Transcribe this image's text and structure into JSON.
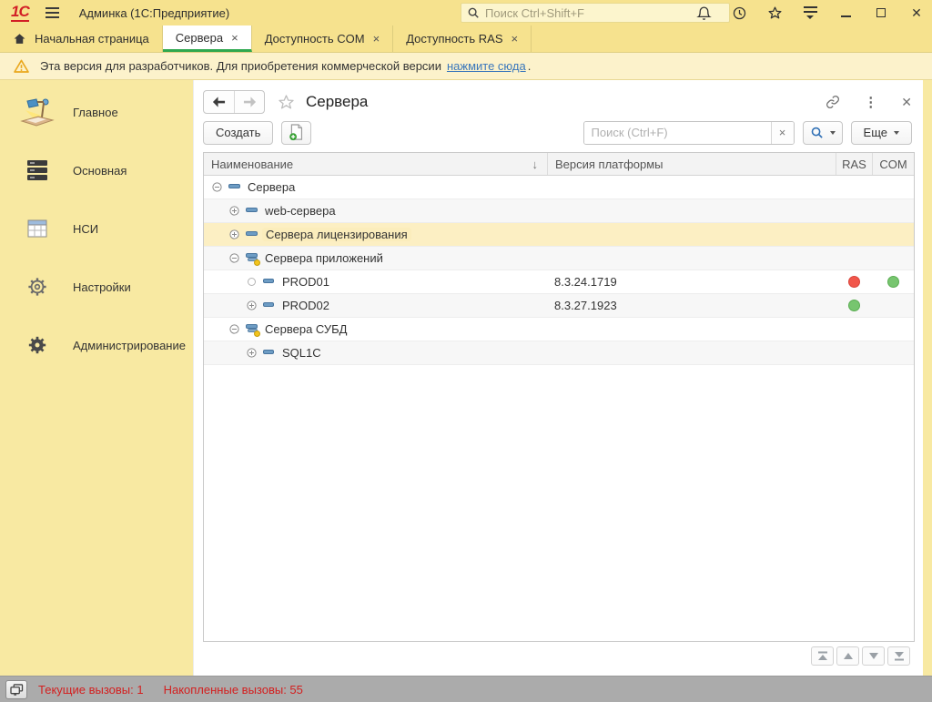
{
  "titlebar": {
    "app_title": "Админка  (1С:Предприятие)",
    "search_placeholder": "Поиск Ctrl+Shift+F"
  },
  "tabs": {
    "home_label": "Начальная страница",
    "items": [
      {
        "label": "Сервера",
        "active": true
      },
      {
        "label": "Доступность COM",
        "active": false
      },
      {
        "label": "Доступность RAS",
        "active": false
      }
    ],
    "close_glyph": "×"
  },
  "banner": {
    "text": "Эта версия для разработчиков. Для приобретения коммерческой версии",
    "link": "нажмите сюда",
    "suffix": "."
  },
  "sidebar": {
    "items": [
      {
        "label": "Главное",
        "icon": "desk-lamp"
      },
      {
        "label": "Основная",
        "icon": "server-stack"
      },
      {
        "label": "НСИ",
        "icon": "table-grid"
      },
      {
        "label": "Настройки",
        "icon": "gear-outline"
      },
      {
        "label": "Администрирование",
        "icon": "gear-solid"
      }
    ]
  },
  "panel": {
    "title": "Сервера",
    "toolbar": {
      "create_label": "Создать",
      "more_label": "Еще",
      "search_placeholder": "Поиск (Ctrl+F)",
      "clear_glyph": "×"
    }
  },
  "table": {
    "columns": [
      "Наименование",
      "Версия платформы",
      "RAS",
      "COM"
    ],
    "sort_glyph": "↓",
    "rows": [
      {
        "level": 0,
        "expander": "minus",
        "icon": "group",
        "name": "Сервера",
        "version": "",
        "ras": null,
        "com": null,
        "selected": false
      },
      {
        "level": 1,
        "expander": "plus",
        "icon": "group",
        "name": "web-сервера",
        "version": "",
        "ras": null,
        "com": null,
        "selected": false
      },
      {
        "level": 1,
        "expander": "plus",
        "icon": "group",
        "name": "Сервера лицензирования",
        "version": "",
        "ras": null,
        "com": null,
        "selected": true
      },
      {
        "level": 1,
        "expander": "minus",
        "icon": "group-dot",
        "name": "Сервера приложений",
        "version": "",
        "ras": null,
        "com": null,
        "selected": false
      },
      {
        "level": 2,
        "expander": "leaf",
        "icon": "item",
        "name": "PROD01",
        "version": "8.3.24.1719",
        "ras": "red",
        "com": "green",
        "selected": false
      },
      {
        "level": 2,
        "expander": "plus",
        "icon": "item",
        "name": "PROD02",
        "version": "8.3.27.1923",
        "ras": "green",
        "com": null,
        "selected": false
      },
      {
        "level": 1,
        "expander": "minus",
        "icon": "group-dot",
        "name": "Сервера СУБД",
        "version": "",
        "ras": null,
        "com": null,
        "selected": false
      },
      {
        "level": 2,
        "expander": "plus",
        "icon": "item",
        "name": "SQL1C",
        "version": "",
        "ras": null,
        "com": null,
        "selected": false
      }
    ]
  },
  "statusbar": {
    "current": "Текущие вызовы: 1",
    "accumulated": "Накопленные вызовы: 55"
  },
  "colors": {
    "titlebar_bg": "#f6e28e",
    "sidebar_bg": "#f8e9a2",
    "banner_bg": "#fcf2cb",
    "active_tab_underline": "#2fa84f",
    "selected_row_bg": "#fcefc3",
    "selection_border": "#dda712",
    "ras_red": "#f1564a",
    "ok_green": "#77c56f",
    "status_text_red": "#d32020",
    "logo_red": "#d21f26",
    "node_icon_blue": "#6d9cc4"
  }
}
